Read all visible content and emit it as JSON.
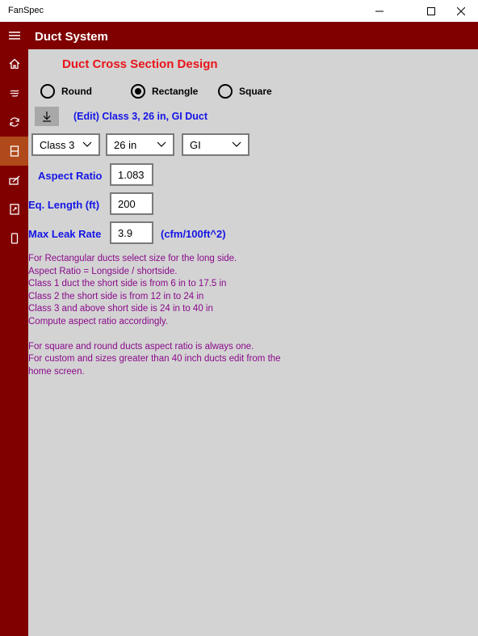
{
  "window": {
    "app_title": "FanSpec"
  },
  "header": {
    "title": "Duct System"
  },
  "sidebar": {
    "items": [
      {
        "icon": "home-icon"
      },
      {
        "icon": "fan-icon"
      },
      {
        "icon": "refresh-icon"
      },
      {
        "icon": "duct-icon",
        "selected": true
      },
      {
        "icon": "gauge-icon"
      },
      {
        "icon": "document-icon"
      },
      {
        "icon": "device-icon"
      }
    ]
  },
  "main": {
    "section_title": "Duct Cross Section Design",
    "shape_options": {
      "round": "Round",
      "rectangle": "Rectangle",
      "square": "Square",
      "selected": "Rectangle"
    },
    "edit_label": "(Edit) Class 3, 26 in, GI Duct",
    "selects": {
      "class_value": "Class 3",
      "size_value": "26 in",
      "material_value": "GI"
    },
    "fields": {
      "aspect_ratio_label": "Aspect Ratio",
      "aspect_ratio_value": "1.083",
      "eq_length_label": "Eq. Length (ft)",
      "eq_length_value": "200",
      "max_leak_label": "Max Leak Rate",
      "max_leak_value": "3.9",
      "max_leak_unit": "(cfm/100ft^2)"
    },
    "info_lines": [
      "For Rectangular ducts select size for the long side.",
      "Aspect Ratio = Longside / shortside.",
      "Class 1 duct the short side is from 6 in to 17.5 in",
      "Class 2 the short side is from 12 in to 24 in",
      "Class 3 and above short side is 24 in to 40 in",
      "Compute aspect ratio accordingly.",
      "",
      "For square and round ducts aspect ratio is always one.",
      "For custom and sizes greater than 40 inch ducts edit from the",
      "home screen."
    ]
  },
  "colors": {
    "brand": "#800000",
    "selected_nav": "#b04a1a",
    "section_title": "#e8141a",
    "label_blue": "#1515e6",
    "info_text": "#8b0a8b",
    "content_bg": "#d3d3d3"
  }
}
